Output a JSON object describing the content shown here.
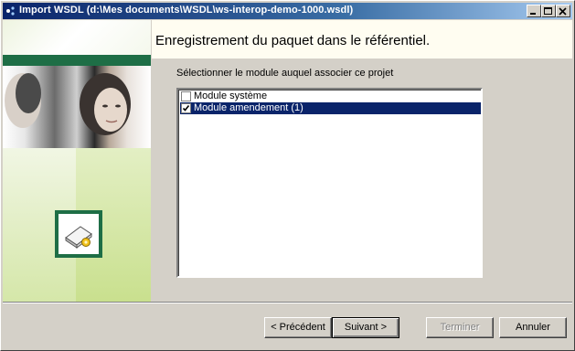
{
  "window": {
    "title": "Import WSDL (d:\\Mes documents\\WSDL\\ws-interop-demo-1000.wsdl)"
  },
  "header": {
    "title": "Enregistrement du paquet dans le référentiel."
  },
  "main": {
    "module_label": "Sélectionner le module auquel associer ce projet",
    "modules": [
      {
        "label": "Module système",
        "checked": false,
        "selected": false
      },
      {
        "label": "Module amendement (1)",
        "checked": true,
        "selected": true
      }
    ]
  },
  "buttons": {
    "previous": "< Précédent",
    "next": "Suivant >",
    "finish": "Terminer",
    "cancel": "Annuler"
  },
  "colors": {
    "title_bar": "#0a246a",
    "selection": "#0a246a",
    "brand_green": "#1e6e46",
    "header_background": "#fffdf1"
  }
}
